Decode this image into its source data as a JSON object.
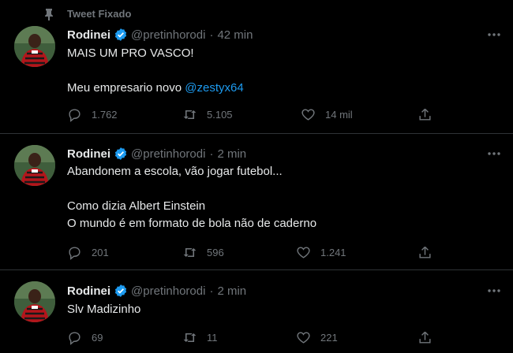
{
  "pinned": {
    "label": "Tweet Fixado",
    "icon": "pin-icon"
  },
  "colors": {
    "background": "#000000",
    "text": "#e7e9ea",
    "muted": "#71767b",
    "link": "#1d9bf0",
    "verified": "#1d9bf0",
    "divider": "#2f3336"
  },
  "tweets": [
    {
      "name": "Rodinei",
      "handle": "@pretinhorodi",
      "separator": "·",
      "time": "42 min",
      "text_main": "MAIS UM PRO VASCO!\n\nMeu empresario novo ",
      "mention": "@zestyx64",
      "replies": "1.762",
      "retweets": "5.105",
      "likes": "14 mil"
    },
    {
      "name": "Rodinei",
      "handle": "@pretinhorodi",
      "separator": "·",
      "time": "2 min",
      "text_main": "Abandonem a escola, vão jogar futebol...\n\nComo dizia Albert Einstein\nO mundo é em formato de bola não de caderno",
      "replies": "201",
      "retweets": "596",
      "likes": "1.241"
    },
    {
      "name": "Rodinei",
      "handle": "@pretinhorodi",
      "separator": "·",
      "time": "2 min",
      "text_main": "Slv Madizinho",
      "replies": "69",
      "retweets": "11",
      "likes": "221"
    }
  ]
}
